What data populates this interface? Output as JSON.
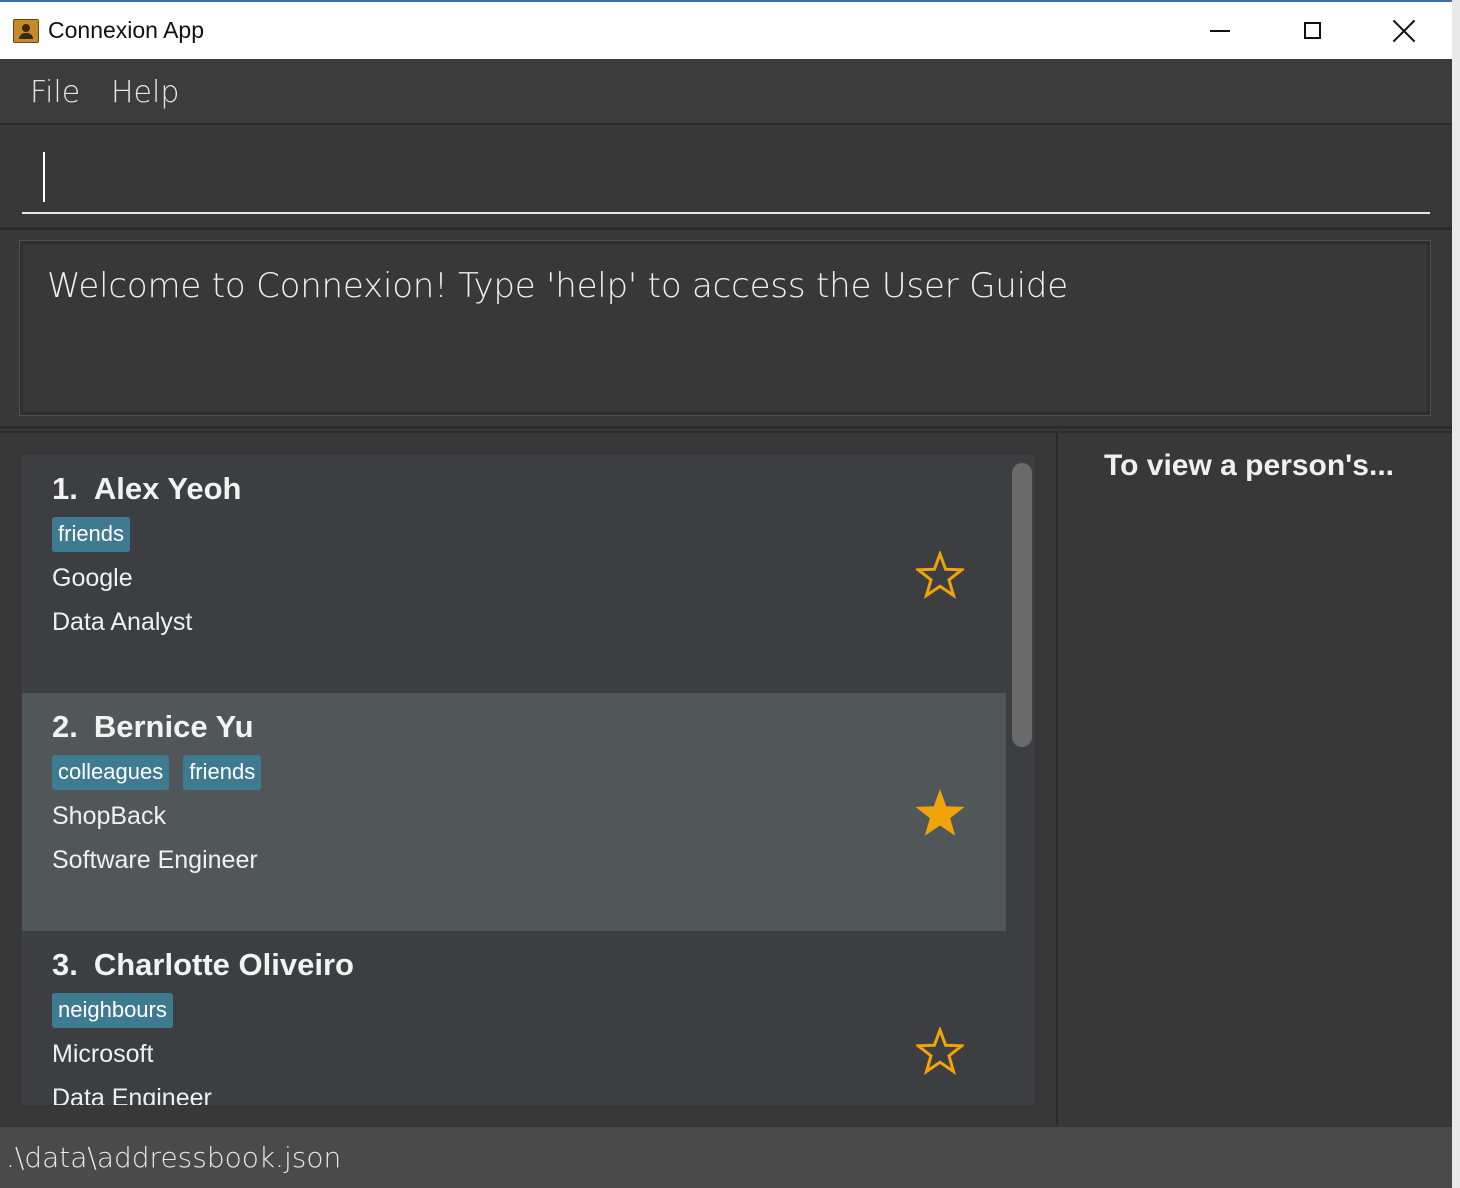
{
  "window": {
    "title": "Connexion App"
  },
  "menu": {
    "file": "File",
    "help": "Help"
  },
  "command": {
    "value": ""
  },
  "result": {
    "message": "Welcome to Connexion! Type 'help' to access the User Guide"
  },
  "persons": [
    {
      "index": "1.",
      "name": "Alex Yeoh",
      "tags": [
        "friends"
      ],
      "company": "Google",
      "role": "Data Analyst",
      "favourite": false
    },
    {
      "index": "2.",
      "name": "Bernice Yu",
      "tags": [
        "colleagues",
        "friends"
      ],
      "company": "ShopBack",
      "role": "Software Engineer",
      "favourite": true
    },
    {
      "index": "3.",
      "name": "Charlotte Oliveiro",
      "tags": [
        "neighbours"
      ],
      "company": "Microsoft",
      "role": "Data Engineer",
      "favourite": false
    }
  ],
  "detail": {
    "placeholder": "To view a person's..."
  },
  "status": {
    "path": ".\\data\\addressbook.json"
  },
  "colors": {
    "accent_tag": "#3e7b91",
    "star": "#f0a30a",
    "background": "#383838",
    "selected_card": "#515658"
  },
  "icons": {
    "app": "contact-book-icon",
    "favourite": "star-icon"
  }
}
